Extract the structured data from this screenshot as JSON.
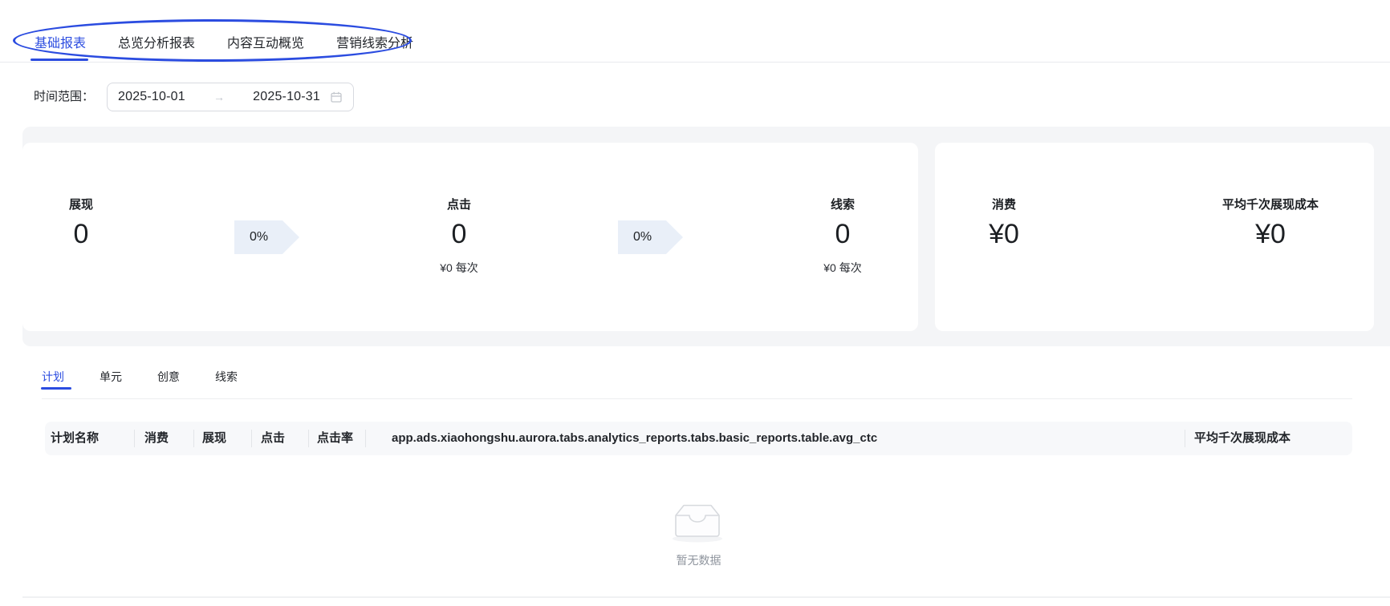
{
  "tabs_primary": {
    "items": [
      {
        "label": "基础报表",
        "active": true
      },
      {
        "label": "总览分析报表",
        "active": false
      },
      {
        "label": "内容互动概览",
        "active": false
      },
      {
        "label": "营销线索分析",
        "active": false
      }
    ]
  },
  "filters": {
    "date_label": "时间范围：",
    "start_date": "2025-10-01",
    "end_date": "2025-10-31",
    "range_separator": "→"
  },
  "summary": {
    "impressions": {
      "label": "展现",
      "value": "0"
    },
    "ctr_impr_to_click": {
      "value": "0%"
    },
    "clicks": {
      "label": "点击",
      "value": "0",
      "sub": "¥0 每次"
    },
    "ctr_click_to_lead": {
      "value": "0%"
    },
    "leads": {
      "label": "线索",
      "value": "0",
      "sub": "¥0 每次"
    },
    "spend": {
      "label": "消费",
      "value": "¥0"
    },
    "avg_cpm": {
      "label": "平均千次展现成本",
      "value": "¥0"
    }
  },
  "tabs_secondary": {
    "items": [
      {
        "label": "计划",
        "active": true
      },
      {
        "label": "单元",
        "active": false
      },
      {
        "label": "创意",
        "active": false
      },
      {
        "label": "线索",
        "active": false
      }
    ]
  },
  "table": {
    "columns": [
      "计划名称",
      "消费",
      "展现",
      "点击",
      "点击率",
      "app.ads.xiaohongshu.aurora.tabs.analytics_reports.tabs.basic_reports.table.avg_ctc",
      "平均千次展现成本"
    ]
  },
  "empty": {
    "text": "暂无数据"
  },
  "colors": {
    "accent_blue": "#2b4ce0",
    "chevron_bg": "#e9eff8",
    "summary_bg": "#f4f5f7",
    "table_header_bg": "#f7f8fa"
  }
}
